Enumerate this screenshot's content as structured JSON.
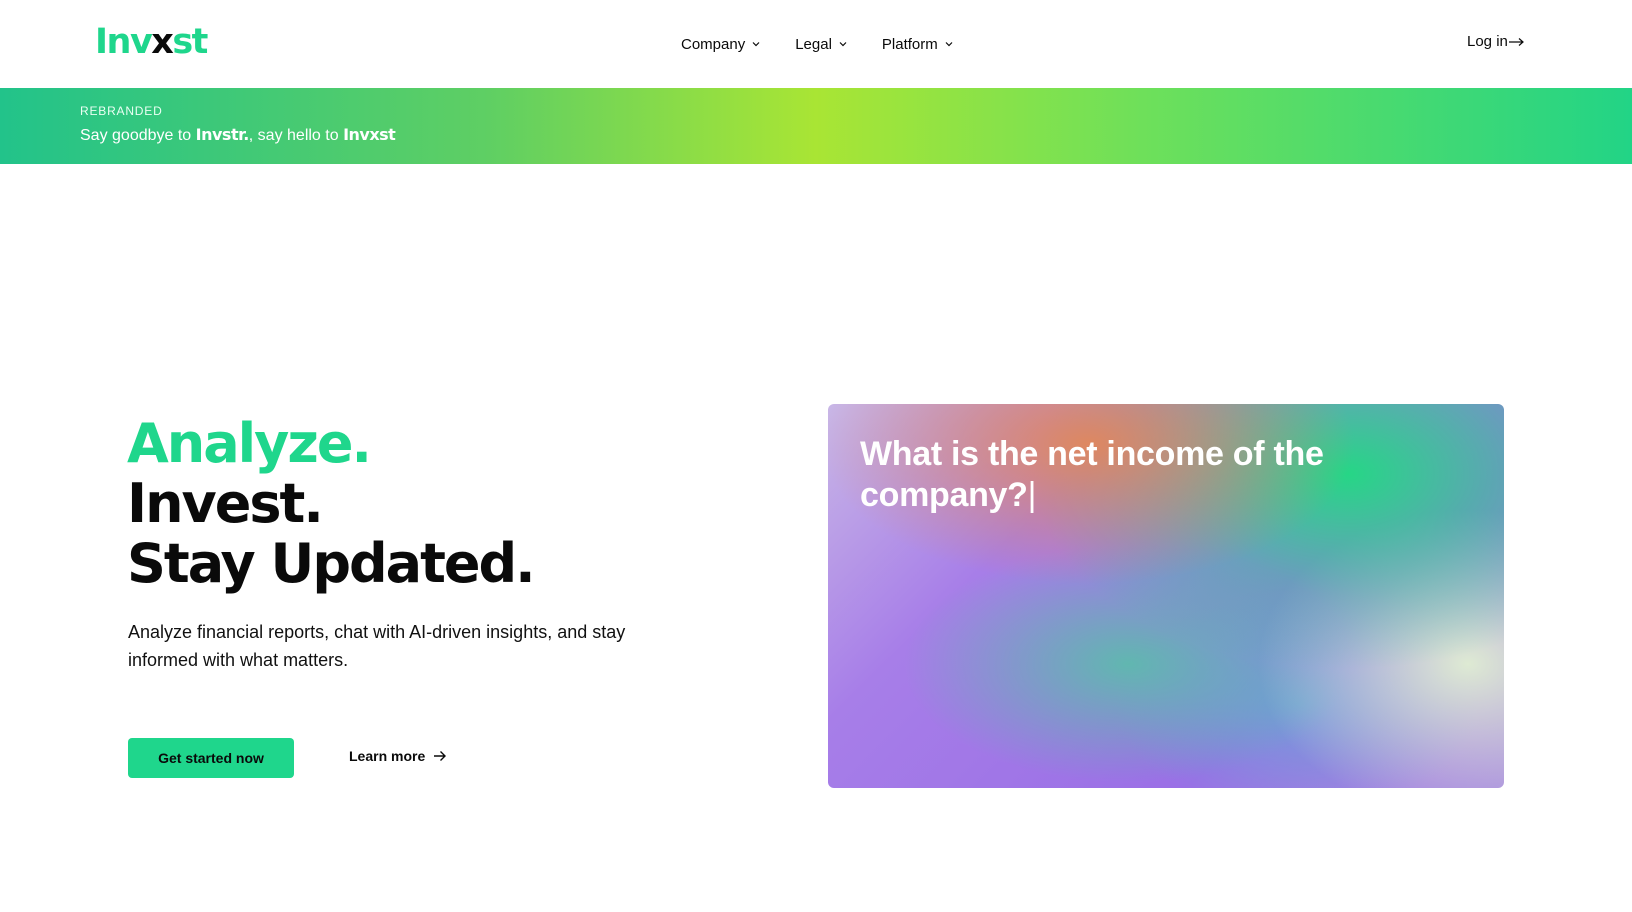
{
  "header": {
    "logo": {
      "part1": "Inv",
      "part2": "x",
      "part3": "st"
    },
    "nav": [
      {
        "label": "Company"
      },
      {
        "label": "Legal"
      },
      {
        "label": "Platform"
      }
    ],
    "login_label": "Log in"
  },
  "banner": {
    "tag": "REBRANDED",
    "text_prefix": "Say goodbye to ",
    "old_brand": "Invstr.",
    "text_middle": ", say hello to ",
    "new_brand": "Invxst"
  },
  "hero": {
    "headline": [
      "Analyze.",
      "Invest.",
      "Stay Updated."
    ],
    "subtext": "Analyze financial reports, chat with AI-driven insights, and stay informed with what matters.",
    "cta_label": "Get started now",
    "learn_more_label": "Learn more"
  },
  "card": {
    "question": "What is the net income of the company?",
    "caret": "|"
  },
  "colors": {
    "brand_green": "#1fd68c",
    "text_dark": "#0a0a0a"
  },
  "icons": {
    "nav_dropdown": "chevron-down-icon",
    "login": "arrow-right-icon",
    "learn_more": "arrow-right-icon"
  }
}
